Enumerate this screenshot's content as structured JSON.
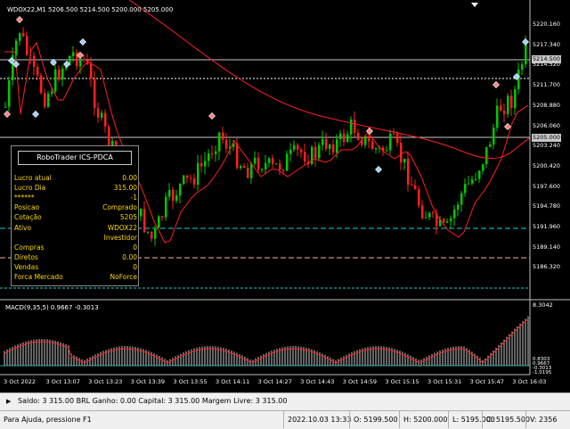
{
  "chart": {
    "symbol_info": "WDOX22,M1  5206.500 5214.500 5200.000 5205.000",
    "price_scale": [
      "5220.160",
      "5217.340",
      "5214.520",
      "5211.700",
      "5208.880",
      "5206.060",
      "5203.240",
      "5200.420",
      "5197.600",
      "5194.780",
      "5191.960",
      "5189.140",
      "5186.320"
    ],
    "current_price": "5205.000",
    "target_price": "5214.500",
    "time_labels": [
      "3 Oct 2022",
      "3 Oct 13:07",
      "3 Oct 13:23",
      "3 Oct 13:39",
      "3 Oct 13:55",
      "3 Oct 14:11",
      "3 Oct 14:27",
      "3 Oct 14:43",
      "3 Oct 14:59",
      "3 Oct 15:15",
      "3 Oct 15:31",
      "3 Oct 15:47",
      "3 Oct 16:03"
    ],
    "colors": {
      "bull": "#00c800",
      "bear": "#ff2020",
      "ma": "#ff2020",
      "hline_white": "#c8c8c8",
      "hline_cyan": "#20c8d8",
      "hline_pink": "#ffb0b0"
    }
  },
  "macd": {
    "label": "MACD(9,35,5) 0.9667 -0.3013",
    "scale": [
      "8.3042",
      "-0.3013"
    ],
    "scale_small": [
      "0.8303",
      "0.9667",
      "-0.3013",
      "-1.0195"
    ]
  },
  "panel": {
    "title": "RoboTrader ICS-PDCA",
    "rows": [
      {
        "label": "Lucro atual",
        "value": "0.00"
      },
      {
        "label": "Lucro Dia",
        "value": "315.00"
      },
      {
        "label": "******",
        "value": "-1"
      },
      {
        "label": "Posicao",
        "value": "Comprado"
      },
      {
        "label": "Cotação",
        "value": "5205"
      },
      {
        "label": "Ativo",
        "value": "WDOX22"
      },
      {
        "label": "",
        "value": "Investidor"
      },
      {
        "label": "Compras",
        "value": "0"
      },
      {
        "label": "Diretos",
        "value": "0.00"
      },
      {
        "label": "Vendas",
        "value": "0"
      },
      {
        "label": "Forca Mercado",
        "value": "NoForce"
      }
    ]
  },
  "account": {
    "text": "Saldo: 3 315.00 BRL  Ganho: 0.00  Capital: 3 315.00  Margem Livre: 3 315.00"
  },
  "status": {
    "help": "Para Ajuda, pressione F1",
    "datetime": "2022.10.03 13:33",
    "open": "O: 5199.500",
    "high": "H: 5200.000",
    "low": "L: 5195.000",
    "close": "C: 5195.500",
    "volume": "V: 2356"
  }
}
